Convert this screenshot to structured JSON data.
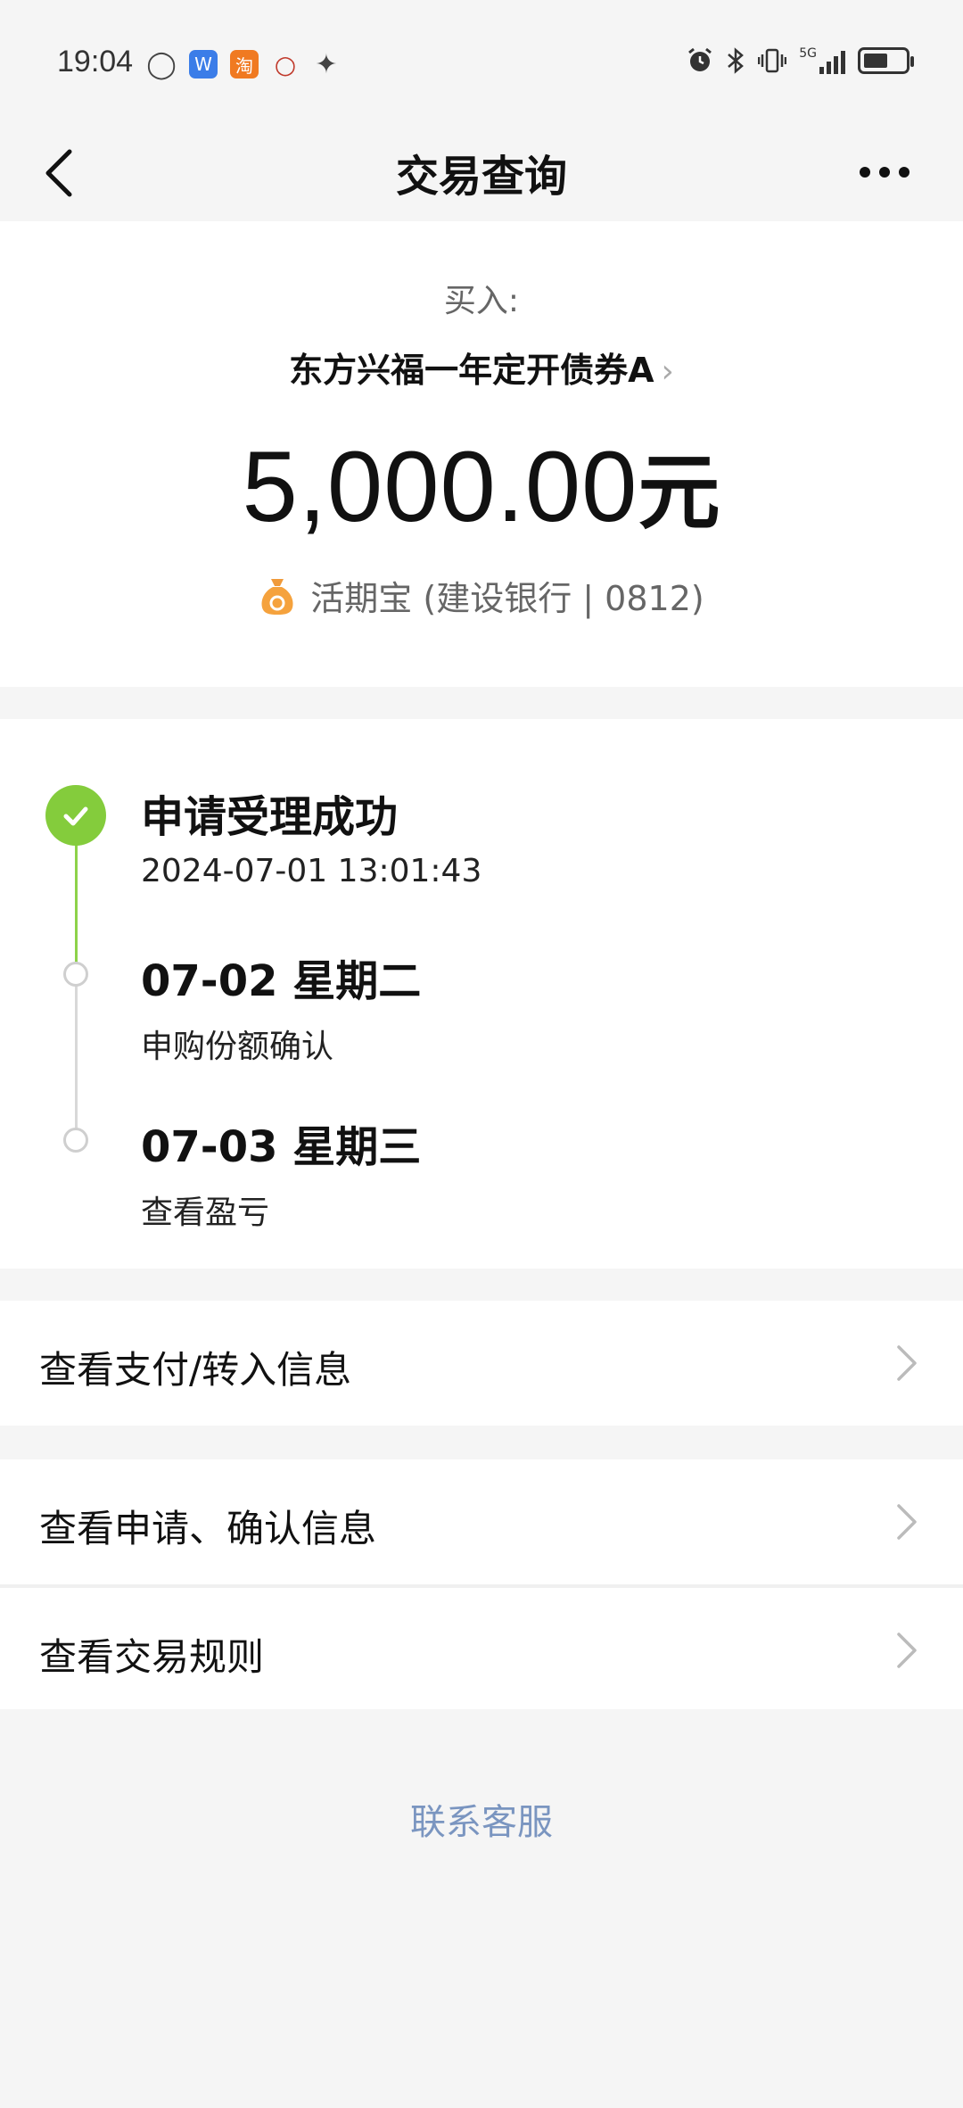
{
  "status_bar": {
    "time": "19:04",
    "left_icons": [
      "chat-bubble-icon",
      "wps-w-icon",
      "taobao-icon",
      "bank-logo-icon",
      "alipay-icon"
    ],
    "right_icons": [
      "alarm-icon",
      "bluetooth-icon",
      "vibrate-icon",
      "5g-signal-icon",
      "battery-icon"
    ],
    "network_label": "5G",
    "battery_level": 0.6,
    "w_label": "W",
    "tao_label": "淘"
  },
  "nav": {
    "title": "交易查询"
  },
  "summary": {
    "action_label": "买入:",
    "fund_name": "东方兴福一年定开债券A",
    "amount": "5,000.00",
    "amount_unit": "元",
    "payment_method": "活期宝 (建设银行 | 0812)"
  },
  "timeline": [
    {
      "title": "申请受理成功",
      "subtitle": "2024-07-01 13:01:43",
      "status": "done"
    },
    {
      "title": "07-02 星期二",
      "subtitle": "申购份额确认",
      "status": "pending"
    },
    {
      "title": "07-03 星期三",
      "subtitle": "查看盈亏",
      "status": "pending"
    }
  ],
  "list_items": [
    {
      "label": "查看支付/转入信息"
    },
    {
      "label": "查看申请、确认信息"
    },
    {
      "label": "查看交易规则"
    }
  ],
  "contact_link": "联系客服",
  "colors": {
    "accent_green": "#84cc3c",
    "link_blue": "#7a95c0",
    "background": "#f5f5f5"
  }
}
